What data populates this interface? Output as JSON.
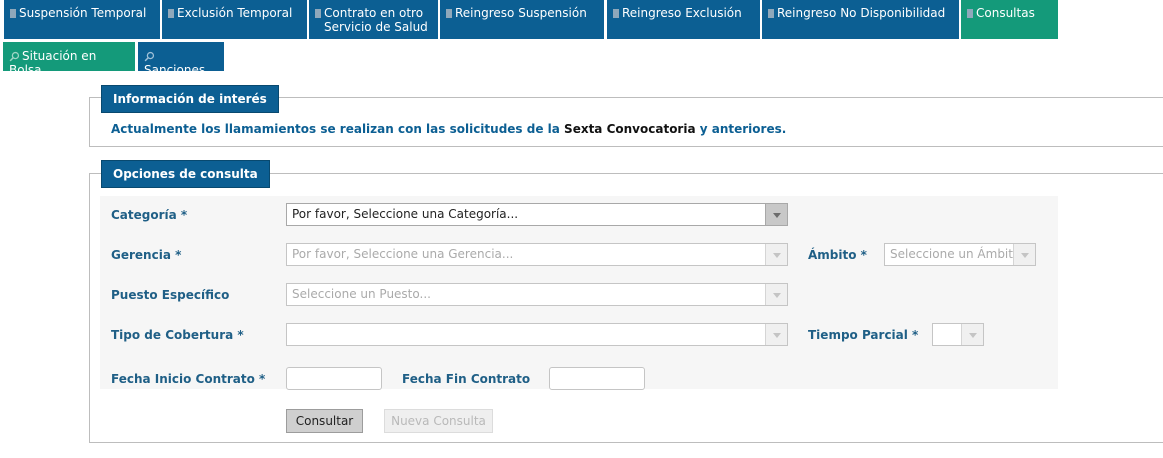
{
  "nav": {
    "tabs": [
      {
        "label": "Suspensión Temporal"
      },
      {
        "label": "Exclusión Temporal"
      },
      {
        "label_line1": "Contrato en otro",
        "label_line2": "Servicio de Salud"
      },
      {
        "label": "Reingreso Suspensión"
      },
      {
        "label": "Reingreso Exclusión"
      },
      {
        "label": "Reingreso No Disponibilidad"
      },
      {
        "label": "Consultas"
      }
    ],
    "subtabs": [
      {
        "label": "Situación en Bolsa"
      },
      {
        "label": "Sanciones"
      }
    ]
  },
  "info": {
    "legend": "Información de interés",
    "text_before": "Actualmente los llamamientos se realizan con las solicitudes de la ",
    "text_highlight": "Sexta Convocatoria",
    "text_after": " y anteriores."
  },
  "options": {
    "legend": "Opciones de consulta",
    "categoria_label": "Categoría *",
    "categoria_value": "Por favor, Seleccione una Categoría...",
    "gerencia_label": "Gerencia *",
    "gerencia_placeholder": "Por favor, Seleccione una Gerencia...",
    "ambito_label": "Ámbito *",
    "ambito_placeholder": "Seleccione un Ámbito...",
    "puesto_label": "Puesto Específico",
    "puesto_placeholder": "Seleccione un Puesto...",
    "cobertura_label": "Tipo de Cobertura *",
    "cobertura_value": "",
    "tiempo_label": "Tiempo Parcial *",
    "tiempo_value": "",
    "fecha_inicio_label": "Fecha Inicio Contrato *",
    "fecha_inicio_value": "",
    "fecha_fin_label": "Fecha Fin Contrato",
    "fecha_fin_value": "",
    "consultar_label": "Consultar",
    "nueva_label": "Nueva Consulta"
  },
  "colors": {
    "tab_blue": "#0c5f93",
    "tab_green": "#149a7a",
    "label_blue": "#1f5f86"
  }
}
